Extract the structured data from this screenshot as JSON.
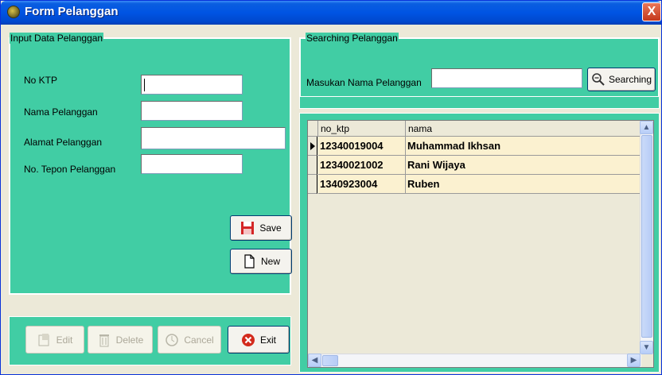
{
  "window": {
    "title": "Form Pelanggan",
    "close_glyph": "X",
    "icon": "app-icon"
  },
  "input_group": {
    "legend": "Input Data Pelanggan",
    "fields": [
      {
        "label": "No KTP",
        "value": ""
      },
      {
        "label": "Nama Pelanggan",
        "value": ""
      },
      {
        "label": "Alamat Pelanggan",
        "value": ""
      },
      {
        "label": "No. Tepon Pelanggan",
        "value": ""
      }
    ],
    "save_label": "Save",
    "new_label": "New"
  },
  "actions": {
    "edit_label": "Edit",
    "delete_label": "Delete",
    "cancel_label": "Cancel",
    "exit_label": "Exit"
  },
  "search_group": {
    "legend": "Searching Pelanggan",
    "label": "Masukan Nama Pelanggan",
    "value": "",
    "button_label": "Searching"
  },
  "grid": {
    "columns": [
      "no_ktp",
      "nama"
    ],
    "rows": [
      {
        "no_ktp": "12340019004",
        "nama": "Muhammad Ikhsan"
      },
      {
        "no_ktp": "12340021002",
        "nama": "Rani Wijaya"
      },
      {
        "no_ktp": "1340923004",
        "nama": "Ruben"
      }
    ],
    "current_row": 0
  },
  "colors": {
    "panel": "#41cda4",
    "titlebar": "#0054e3",
    "row": "#fbf1d0"
  }
}
